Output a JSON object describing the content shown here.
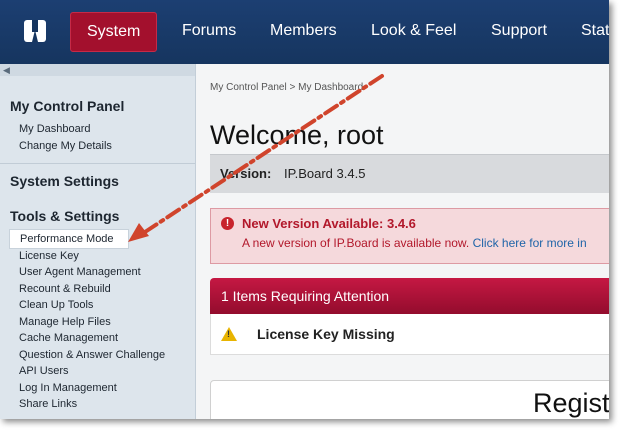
{
  "topnav": {
    "tabs": [
      {
        "label": "System",
        "active": true
      },
      {
        "label": "Forums"
      },
      {
        "label": "Members"
      },
      {
        "label": "Look & Feel"
      },
      {
        "label": "Support"
      },
      {
        "label": "Stat"
      }
    ]
  },
  "sidebar": {
    "my_control_panel": {
      "heading": "My Control Panel",
      "items": [
        "My Dashboard",
        "Change My Details"
      ]
    },
    "system_settings": {
      "heading": "System Settings"
    },
    "tools_settings": {
      "heading": "Tools & Settings",
      "items": [
        "Performance Mode",
        "License Key",
        "User Agent Management",
        "Recount & Rebuild",
        "Clean Up Tools",
        "Manage Help Files",
        "Cache Management",
        "Question & Answer Challenge",
        "API Users",
        "Log In Management",
        "Share Links"
      ],
      "highlighted": "Performance Mode"
    }
  },
  "main": {
    "breadcrumb": {
      "root": "My Control Panel",
      "separator": ">",
      "current": "My Dashboard"
    },
    "title": "Welcome, root",
    "version": {
      "label": "Version:",
      "value": "IP.Board 3.4.5"
    },
    "alert": {
      "icon": "error-icon",
      "title": "New Version Available: 3.4.6",
      "text": "A new version of IP.Board is available now.",
      "link": "Click here for more in"
    },
    "attention": {
      "header": "1 Items Requiring Attention",
      "item": "License Key Missing",
      "icon": "warning-icon"
    },
    "register": {
      "title": "Regist"
    }
  },
  "colors": {
    "nav_bg": "#16355f",
    "active_tab": "#a3102d",
    "attention_header": "#b0123a",
    "annotation_arrow": "#d0442c",
    "link": "#1f64a8"
  }
}
